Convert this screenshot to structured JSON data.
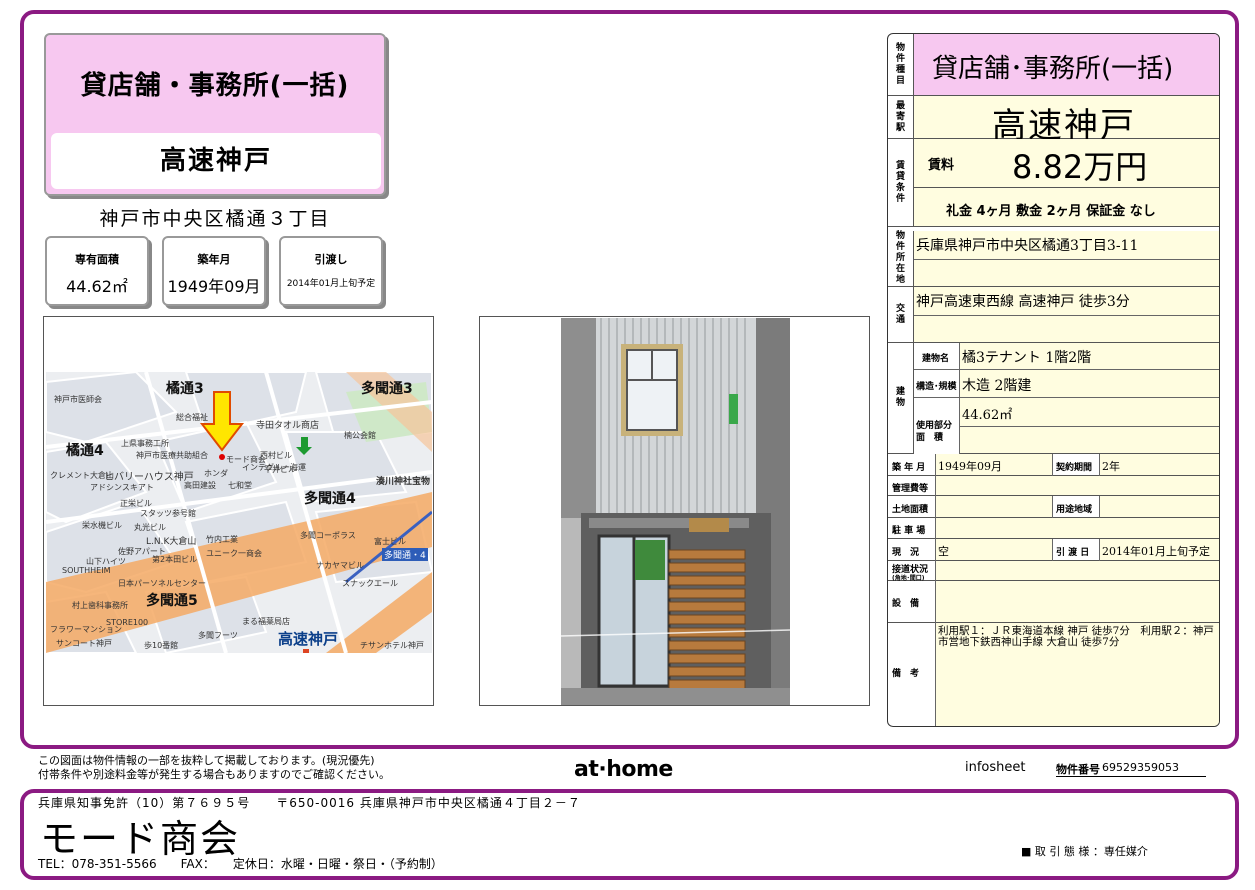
{
  "header": {
    "property_type": "貸店舗・事務所(一括)",
    "station": "高速神戸",
    "address_short": "神戸市中央区橘通３丁目"
  },
  "summary": {
    "area_label": "専有面積",
    "area_value": "44.62㎡",
    "built_label": "築年月",
    "built_value": "1949年09月",
    "handover_label": "引渡し",
    "handover_value": "2014年01月上旬予定"
  },
  "map": {
    "labels": [
      "橘通3",
      "多聞通3",
      "橘通4",
      "多聞通4",
      "多聞通5",
      "高速神戸",
      "湊川神社宝物",
      "多聞通・4",
      "楠公会館",
      "寺田タオル商店"
    ],
    "small_labels": [
      "神戸市医師会",
      "総合福祉",
      "上県事務工所",
      "神戸市医療共助組合",
      "クレメント大倉山",
      "ヒバリーハウス神戸",
      "アドシンスキアト",
      "高田建設",
      "正栄ビル",
      "ホンダ",
      "七和堂",
      "平井ビル",
      "スタッツ参号館",
      "丸光ビル",
      "栄水機ビル",
      "モード商会",
      "L.N.K大倉山",
      "竹内工業",
      "ユニーク一商会",
      "山下ハイツ",
      "SOUTHHEIM",
      "佐野アパート",
      "第2本田ビル",
      "日本パーソネルセンター",
      "村上歯科事務所",
      "STORE100",
      "フラワーマンション",
      "サンコート神戸",
      "まる福薬局店",
      "歩10番館",
      "多聞フーツ",
      "ナカヤマビル",
      "スナックエール",
      "チサンホテル神戸",
      "多聞コーポラス",
      "富士ビル",
      "西村ビル",
      "インテグルー海運"
    ],
    "roads": [
      {
        "name": "main-avenue",
        "width": 56
      },
      {
        "name": "cross-street",
        "width": 14
      }
    ]
  },
  "spec": {
    "type_label": "物件種目",
    "type_value": "貸店舗･事務所(一括)",
    "station_label": "最寄駅",
    "station_value": "高速神戸",
    "rent_label": "賃貸条件",
    "rent_caption": "賃料",
    "rent_value": "8.82万円",
    "fees": "礼金 4ヶ月  敷金 2ヶ月  保証金 なし",
    "location_label": "物件所在地",
    "location_value": "兵庫県神戸市中央区橘通3丁目3-11",
    "transport_label": "交通",
    "transport_value": "神戸高速東西線 高速神戸 徒歩3分",
    "building_label": "建物",
    "building_name_label": "建物名",
    "building_name": "橘3テナント 1階2階",
    "structure_label": "構造･規模",
    "structure_value": "木造 2階建",
    "usage_label_1": "使用部分",
    "usage_label_2": "面　積",
    "usage_value": "44.62㎡",
    "built_label": "築 年 月",
    "built_value": "1949年09月",
    "contract_label": "契約期間",
    "contract_value": "2年",
    "mgmt_label": "管理費等",
    "land_label": "土地面積",
    "zoning_label": "用途地域",
    "parking_label": "駐 車 場",
    "status_label": "現　況",
    "status_value": "空",
    "handover_label": "引 渡 日",
    "handover_value": "2014年01月上旬予定",
    "access_label": "接道状況",
    "access_sub": "(角地･間口)",
    "equipment_label": "設　備",
    "notes_label": "備　考",
    "notes_value": "利用駅１：ＪＲ東海道本線 神戸 徒歩7分　利用駅２：神戸市営地下鉄西神山手線 大倉山 徒歩7分"
  },
  "footer": {
    "disclaimer_1": "この図面は物件情報の一部を抜粋して掲載しております。(現況優先)",
    "disclaimer_2": "付帯条件や別途料金等が発生する場合もありますのでご確認ください。",
    "brand": "at·home",
    "infosheet": "infosheet",
    "property_no_label": "物件番号",
    "property_no": "69529359053",
    "license": "兵庫県知事免許（10）第７６９５号　　〒650-0016 兵庫県神戸市中央区橘通４丁目２－７",
    "company": "モード商会",
    "contact": "TEL：078-351-5566　　FAX：　　定休日：水曜・日曜・祭日・（予約制）",
    "deal_type": "■ 取 引 態 様 ：専任媒介"
  },
  "colors": {
    "frame": "#8b1a82",
    "pink": "#f7c8f0",
    "yellow_cell": "#fffde0",
    "map_road": "#f4a964",
    "map_block": "#e3e6ec"
  }
}
